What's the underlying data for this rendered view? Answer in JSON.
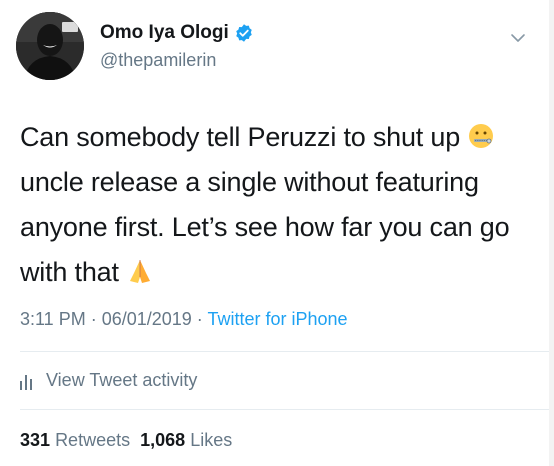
{
  "author": {
    "display_name": "Omo Iya Ologi",
    "handle": "@thepamilerin"
  },
  "tweet": {
    "text_before_emoji1": "Can somebody tell Peruzzi to shut up ",
    "text_middle": "uncle release a single without featuring anyone first. Let’s see how far you can go with that ",
    "emoji1": "zipper-mouth-face",
    "emoji2": "folded-hands"
  },
  "meta": {
    "time": "3:11 PM",
    "date": "06/01/2019",
    "separator": " · ",
    "source": "Twitter for iPhone"
  },
  "activity": {
    "label": "View Tweet activity"
  },
  "stats": {
    "retweets_count": "331",
    "retweets_label": "Retweets",
    "likes_count": "1,068",
    "likes_label": "Likes"
  },
  "icons": {
    "verified": "verified-badge-icon",
    "chevron": "chevron-down-icon",
    "activity": "bar-chart-icon"
  },
  "colors": {
    "link": "#1da1f2",
    "secondary": "#657786",
    "primary": "#14171a",
    "divider": "#e6ecf0"
  }
}
